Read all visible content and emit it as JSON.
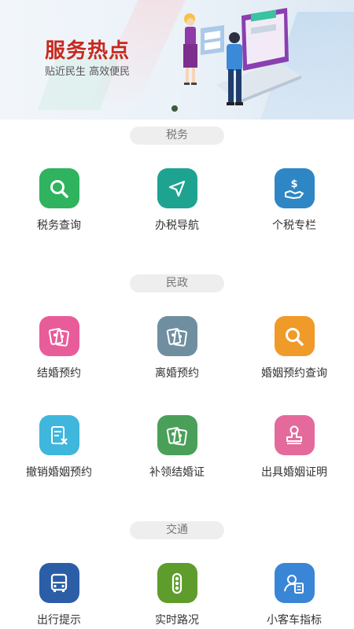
{
  "banner": {
    "title": "服务热点",
    "subtitle": "贴近民生  高效便民",
    "carousel_active_index": 0
  },
  "sections": [
    {
      "label": "税务",
      "items": [
        {
          "label": "税务查询",
          "icon": "search-icon",
          "color": "#2fb35e"
        },
        {
          "label": "办税导航",
          "icon": "navigation-arrow-icon",
          "color": "#1ea391"
        },
        {
          "label": "个税专栏",
          "icon": "hand-dollar-icon",
          "color": "#2f86c4"
        }
      ]
    },
    {
      "label": "民政",
      "items": [
        {
          "label": "结婚预约",
          "icon": "marriage-certificate-icon",
          "color": "#e85c9a"
        },
        {
          "label": "离婚预约",
          "icon": "marriage-certificate-icon",
          "color": "#6f8fa0"
        },
        {
          "label": "婚姻预约查询",
          "icon": "search-icon",
          "color": "#f09a2a"
        },
        {
          "label": "撤销婚姻预约",
          "icon": "cancel-document-icon",
          "color": "#3fb6dc"
        },
        {
          "label": "补领结婚证",
          "icon": "marriage-certificate-icon",
          "color": "#4aa059"
        },
        {
          "label": "出具婚姻证明",
          "icon": "stamp-icon",
          "color": "#e46a9c"
        }
      ]
    },
    {
      "label": "交通",
      "items": [
        {
          "label": "出行提示",
          "icon": "bus-icon",
          "color": "#2c5ea8"
        },
        {
          "label": "实时路况",
          "icon": "traffic-light-icon",
          "color": "#5e9c2c"
        },
        {
          "label": "小客车指标",
          "icon": "user-document-icon",
          "color": "#3a86d6"
        }
      ]
    }
  ]
}
